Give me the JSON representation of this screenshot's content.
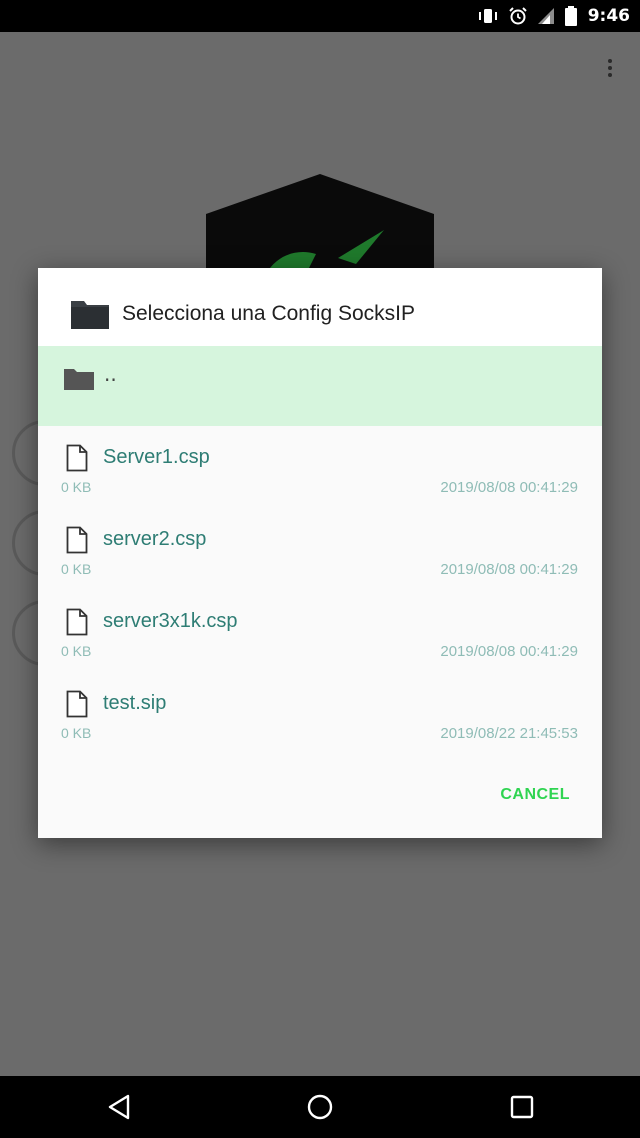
{
  "status_bar": {
    "time": "9:46",
    "icons": [
      "vibrate-icon",
      "alarm-icon",
      "signal-icon",
      "battery-icon"
    ]
  },
  "app": {
    "icons": [
      "overflow-menu-icon",
      "shield-logo-icon"
    ]
  },
  "dialog": {
    "title": "Selecciona una Config SocksIP",
    "parent_label": "..",
    "files": [
      {
        "name": "Server1.csp",
        "size": "0 KB",
        "date": "2019/08/08 00:41:29"
      },
      {
        "name": "server2.csp",
        "size": "0 KB",
        "date": "2019/08/08 00:41:29"
      },
      {
        "name": "server3x1k.csp",
        "size": "0 KB",
        "date": "2019/08/08 00:41:29"
      },
      {
        "name": "test.sip",
        "size": "0 KB",
        "date": "2019/08/22 21:45:53"
      }
    ],
    "cancel_label": "CANCEL"
  },
  "nav_bar": {
    "icons": [
      "back-icon",
      "home-icon",
      "recents-icon"
    ]
  },
  "colors": {
    "accent": "#2fd451",
    "file_text": "#2e7d74",
    "selected_row": "#d6f5dd"
  }
}
